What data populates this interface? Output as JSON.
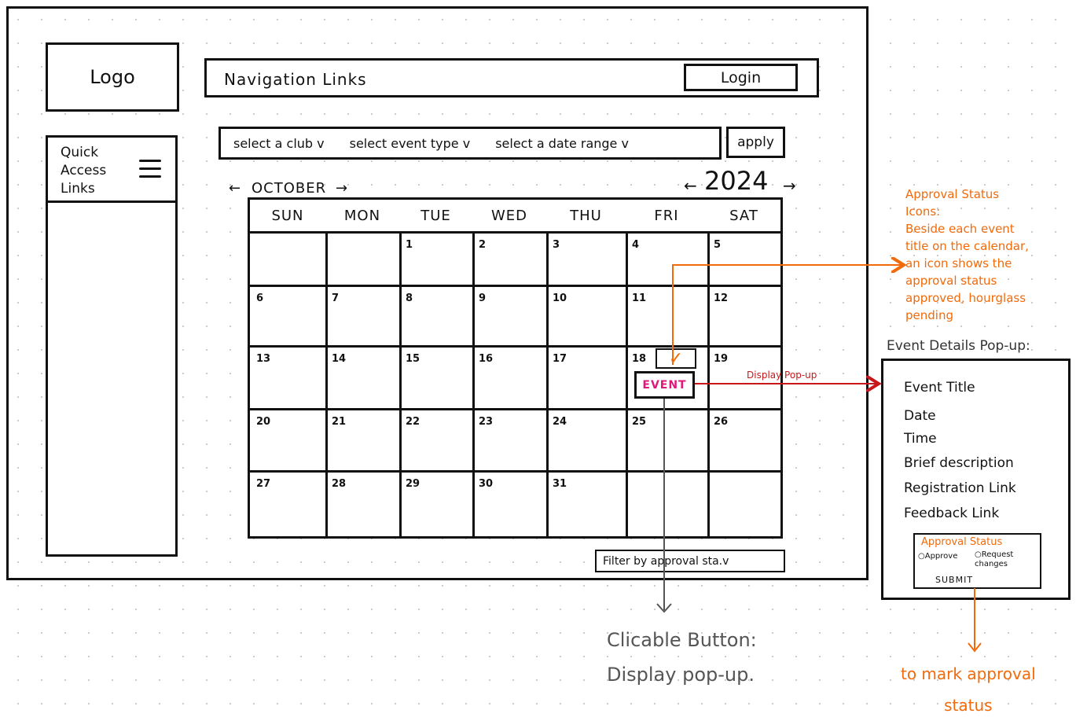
{
  "logo": {
    "label": "Logo"
  },
  "nav": {
    "label": "Navigation Links",
    "login_label": "Login"
  },
  "sidebar": {
    "label": "Quick\nAccess\nLinks",
    "menu_icon": "hamburger-menu-icon"
  },
  "filters": {
    "club": "select a club v",
    "event_type": "select event type v",
    "date_range": "select a date range v",
    "apply_label": "apply"
  },
  "calendar": {
    "month": "OCTOBER",
    "year": "2024",
    "prev_icon": "←",
    "next_icon": "→",
    "day_names": [
      "SUN",
      "MON",
      "TUE",
      "WED",
      "THU",
      "FRI",
      "SAT"
    ],
    "weeks": [
      [
        "",
        "",
        "1",
        "2",
        "3",
        "4",
        "5"
      ],
      [
        "6",
        "7",
        "8",
        "9",
        "10",
        "11",
        "12"
      ],
      [
        "13",
        "14",
        "15",
        "16",
        "17",
        "18",
        "19"
      ],
      [
        "20",
        "21",
        "22",
        "23",
        "24",
        "25",
        "26"
      ],
      [
        "27",
        "28",
        "29",
        "30",
        "31",
        "",
        ""
      ]
    ],
    "event_label": "EVENT",
    "approval_icon": "✓",
    "approval_filter_label": "Filter by approval sta.v"
  },
  "annotations": {
    "approval_icons_note": "Approval Status\nIcons:\n  Beside each event\ntitle on the calendar,\nan icon shows the\napproval status\napproved, hourglass\npending",
    "popup_heading": "Event Details Pop-up:",
    "display_popup": "Display Pop-up",
    "clickable_button": "Clicable Button:\n  Display pop-up.",
    "mark_status": "to mark approval\nstatus"
  },
  "popup": {
    "lines": [
      "Event Title",
      "Date",
      "Time",
      "Brief description",
      "Registration Link",
      "Feedback Link"
    ],
    "approval_title": "Approval Status",
    "approve_label": "○Approve",
    "request_changes_label": "○Request\n  changes",
    "submit_label": "SUBMIT"
  },
  "colors": {
    "annotation_orange": "#f26a0a",
    "event_pink": "#e0187a",
    "arrow_red": "#c8171b",
    "arrow_gray": "#555555"
  }
}
